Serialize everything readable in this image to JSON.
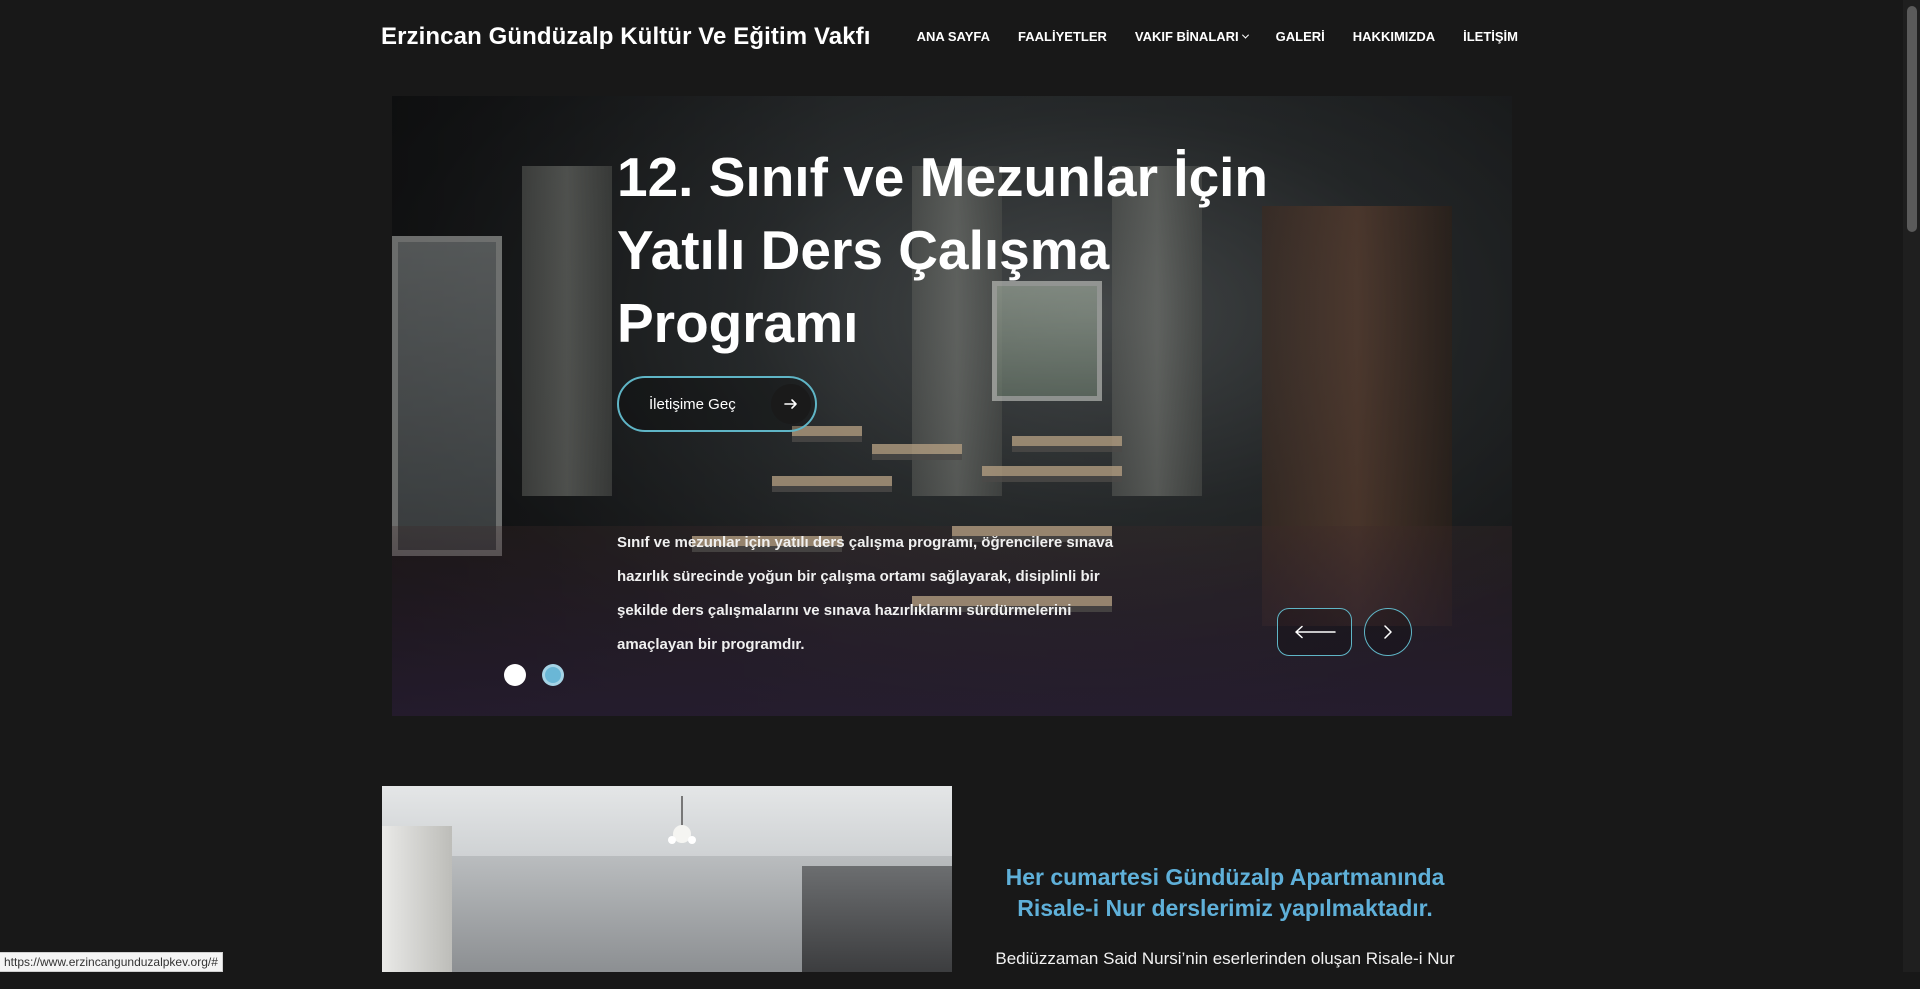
{
  "header": {
    "brand": "Erzincan Gündüzalp Kültür Ve Eğitim Vakfı",
    "nav": [
      {
        "label": "ANA SAYFA"
      },
      {
        "label": "FAALİYETLER"
      },
      {
        "label": "VAKIF BİNALARI",
        "has_dropdown": true
      },
      {
        "label": "GALERİ"
      },
      {
        "label": "HAKKIMIZDA"
      },
      {
        "label": "İLETİŞİM"
      }
    ]
  },
  "hero": {
    "title_line1": "12. Sınıf ve Mezunlar İçin",
    "title_line2": "Yatılı Ders Çalışma",
    "title_line3": "Programı",
    "cta_label": "İletişime Geç",
    "cta_icon": "arrow-right-icon",
    "description": "Sınıf ve mezunlar için yatılı ders çalışma programı, öğrencilere sınava hazırlık sürecinde yoğun bir çalışma ortamı sağlayarak, disiplinli bir şekilde ders çalışmalarını ve sınava hazırlıklarını sürdürmelerini amaçlayan bir programdır.",
    "slide_count": 2,
    "active_slide": 2,
    "prev_icon": "arrow-left-icon",
    "next_icon": "chevron-right-icon"
  },
  "lower": {
    "heading_line1": "Her cumartesi Gündüzalp Apartmanında",
    "heading_line2": "Risale-i Nur derslerimiz yapılmaktadır.",
    "body": "Bediüzzaman Said Nursi’nin eserlerinden oluşan Risale-i Nur"
  },
  "status_url": "https://www.erzincangunduzalpkev.org/#",
  "colors": {
    "background": "#181818",
    "accent": "#5fb5c6",
    "heading_blue": "#5fb0d9",
    "active_dot": "#6ab7d6"
  }
}
